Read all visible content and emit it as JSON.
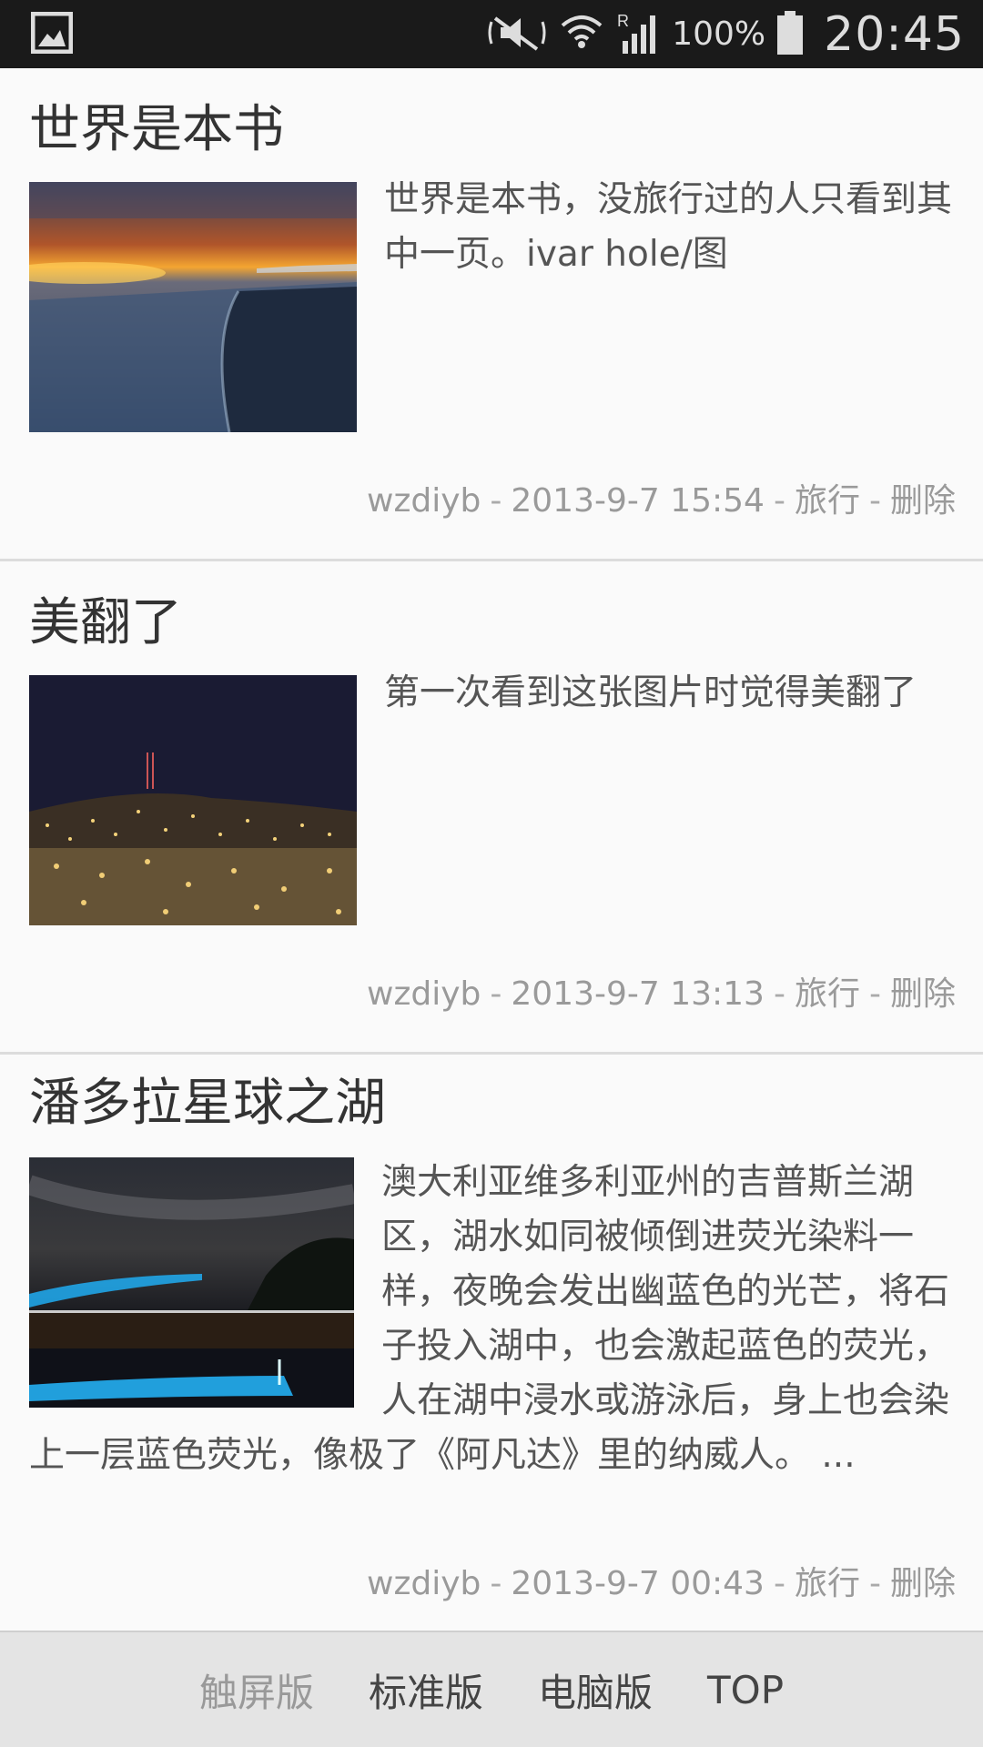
{
  "status_bar": {
    "battery_percent": "100%",
    "time": "20:45",
    "icons": [
      "gallery-icon",
      "mute-icon",
      "wifi-icon",
      "signal-icon",
      "battery-icon"
    ]
  },
  "posts": [
    {
      "title": "世界是本书",
      "text": "世界是本书，没旅行过的人只看到其中一页。ivar hole/图",
      "author": "wzdiyb",
      "date": "2013-9-7 15:54",
      "category": "旅行",
      "delete_label": "删除",
      "sep": "-"
    },
    {
      "title": "美翻了",
      "text": "第一次看到这张图片时觉得美翻了",
      "author": "wzdiyb",
      "date": "2013-9-7 13:13",
      "category": "旅行",
      "delete_label": "删除",
      "sep": "-"
    },
    {
      "title": "潘多拉星球之湖",
      "text": "澳大利亚维多利亚州的吉普斯兰湖区，湖水如同被倾倒进荧光染料一样，夜晚会发出幽蓝色的光芒，将石子投入湖中，也会激起蓝色的荧光，人在湖中浸水或游泳后，身上也会染上一层蓝色荧光，像极了《阿凡达》里的纳威人。 ...",
      "author": "wzdiyb",
      "date": "2013-9-7 00:43",
      "category": "旅行",
      "delete_label": "删除",
      "sep": "-"
    }
  ],
  "footer": {
    "touch": "触屏版",
    "standard": "标准版",
    "pc": "电脑版",
    "top": "TOP"
  }
}
